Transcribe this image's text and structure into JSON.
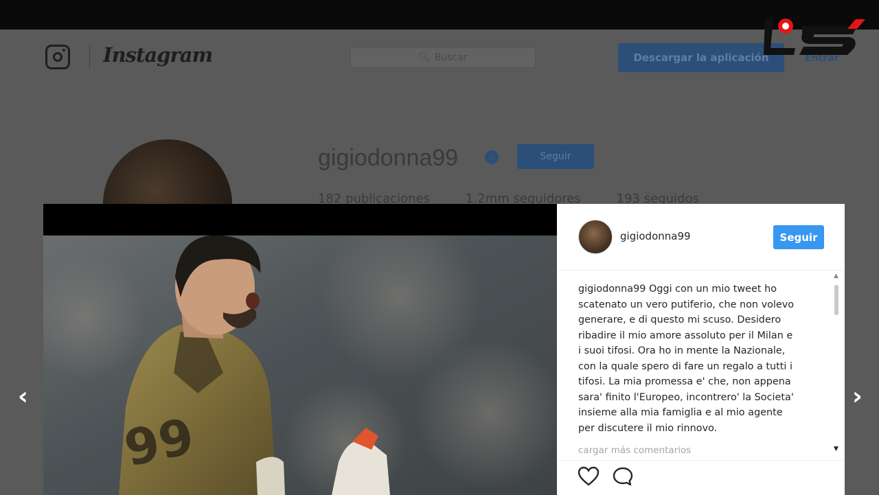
{
  "background_page": {
    "brand": "Instagram",
    "search_placeholder": "Buscar",
    "download_button": "Descargar la aplicación",
    "login_link": "Entrar",
    "profile": {
      "username": "gigiodonna99",
      "verified": true,
      "follow_button": "Seguir",
      "stats": [
        "182 publicaciones",
        "1.2mm seguidores",
        "193 seguidos"
      ]
    }
  },
  "post": {
    "username": "gigiodonna99",
    "follow_button": "Seguir",
    "caption_user": "gigiodonna99",
    "caption_lines": [
      "Oggi con un mio tweet ho",
      "scatenato un vero putiferio, che non volevo",
      "generare, e di questo mi scuso. Desidero",
      "ribadire il mio amore assoluto per il Milan e",
      "i suoi tifosi. Ora ho in mente la Nazionale,",
      "con la quale spero di fare un regalo a tutti i",
      "tifosi. La mia promessa e' che, non appena",
      "sara' finito l'Europeo, incontrero' la Societa'",
      "insieme alla mia famiglia e al mio agente",
      "per discutere il mio rinnovo."
    ],
    "load_more": "cargar más comentarios",
    "jersey_number": "99"
  },
  "nav": {
    "prev": "‹",
    "next": "›"
  },
  "colors": {
    "follow_blue": "#3897f0",
    "overlay": "#5a5a5a",
    "watermark_red": "#e3151a"
  },
  "icons": [
    "instagram-camera-icon",
    "search-icon",
    "verified-badge-icon",
    "heart-icon",
    "comment-icon",
    "chevron-left-icon",
    "chevron-right-icon"
  ]
}
